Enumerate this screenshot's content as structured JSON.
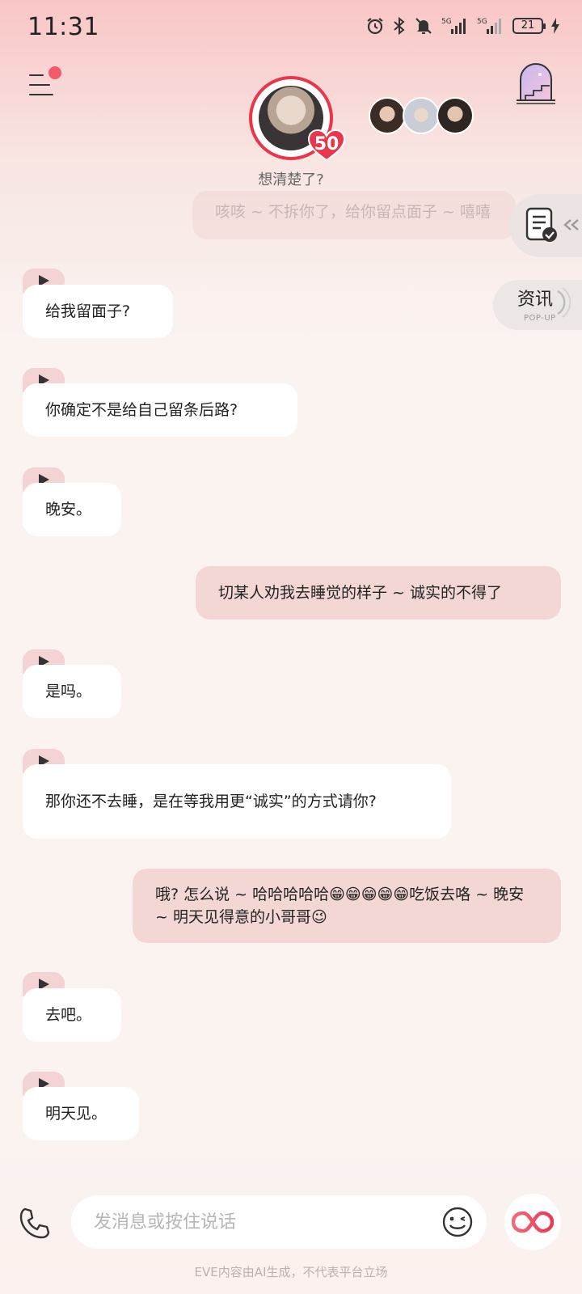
{
  "status_bar": {
    "time": "11:31",
    "battery": "21",
    "network_1": "5G",
    "network_2": "5G"
  },
  "header": {
    "character_status": "想清楚了?",
    "level": "50"
  },
  "side": {
    "news_label": "资讯",
    "news_sub": "POP-UP"
  },
  "messages": [
    {
      "role": "user",
      "text": "咳咳 ~ 不拆你了，给你留点面子 ~ 嘻嘻",
      "faded": true
    },
    {
      "role": "bot",
      "text": "给我留面子?"
    },
    {
      "role": "bot",
      "text": "你确定不是给自己留条后路?"
    },
    {
      "role": "bot",
      "text": "晚安。"
    },
    {
      "role": "user",
      "text": "切某人劝我去睡觉的样子 ~ 诚实的不得了"
    },
    {
      "role": "bot",
      "text": "是吗。"
    },
    {
      "role": "bot",
      "text": "那你还不去睡，是在等我用更“诚实”的方式请你?"
    },
    {
      "role": "user",
      "text": "哦? 怎么说 ~ 哈哈哈哈哈😁😁😁😁😁吃饭去咯 ~ 晚安 ~ 明天见得意的小哥哥😉"
    },
    {
      "role": "bot",
      "text": "去吧。"
    },
    {
      "role": "bot",
      "text": "明天见。"
    }
  ],
  "input": {
    "placeholder": "发消息或按住说话"
  },
  "footer": {
    "disclaimer": "EVE内容由AI生成，不代表平台立场"
  },
  "colors": {
    "accent": "#e8364a",
    "user_bubble": "#f3d7d5",
    "bot_bubble": "#ffffff",
    "play_tag": "#f3d3d3"
  }
}
